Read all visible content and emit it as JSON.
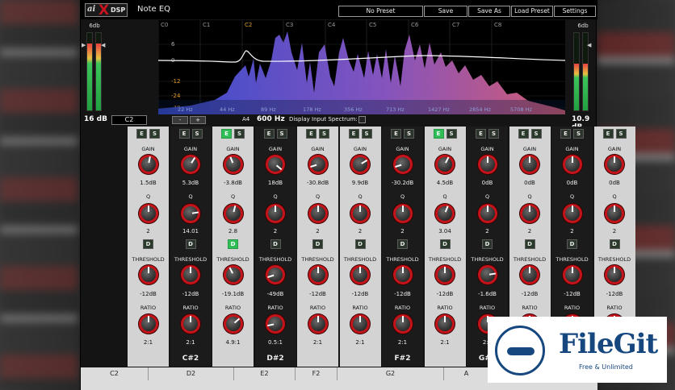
{
  "app": {
    "brand_ai": "ai",
    "brand_x": "X",
    "brand_dsp": "DSP",
    "title": "Note EQ"
  },
  "toolbar": {
    "preset_label": "No Preset",
    "save_label": "Save",
    "save_as_label": "Save As",
    "load_preset_label": "Load Preset",
    "settings_label": "Settings"
  },
  "meters": {
    "left_label": "6db",
    "right_label": "6db",
    "left_value": "16 dB",
    "right_value": "10.9 dB",
    "left_levels": [
      0.86,
      0.86
    ],
    "right_levels": [
      0.6,
      0.6
    ]
  },
  "spectrum": {
    "note_labels": [
      "C0",
      "C1",
      "C2",
      "C3",
      "C4",
      "C5",
      "C6",
      "C7",
      "C8"
    ],
    "db_labels": [
      "6",
      "0",
      "-12",
      "-24",
      "-48"
    ],
    "freq_labels": [
      "22 Hz",
      "44 Hz",
      "89 Hz",
      "178 Hz",
      "356 Hz",
      "713 Hz",
      "1427 Hz",
      "2854 Hz",
      "5708 Hz"
    ],
    "colors": {
      "low": "#3a50d8",
      "high": "#e06078",
      "active_note": "#e0a030",
      "curve": "#ffffff"
    }
  },
  "controls": {
    "note": "C2",
    "minus": "-",
    "plus": "+",
    "ref_note": "A4",
    "ref_freq": "600 Hz",
    "display_input_label": "Display Input Spectrum:"
  },
  "labels": {
    "enable": "E",
    "solo": "S",
    "dynamic": "D",
    "gain": "GAIN",
    "q": "Q",
    "threshold": "THRESHOLD",
    "ratio": "RATIO"
  },
  "bands": [
    {
      "name": "",
      "theme": "light",
      "e_on": false,
      "d_on": false,
      "gain": "1.5dB",
      "q": "2",
      "threshold": "-12dB",
      "ratio": "2:1",
      "gain_level": 0.54,
      "q_level": 0.5,
      "threshold_level": 0.5,
      "ratio_level": 0.5
    },
    {
      "name": "C#2",
      "theme": "dark",
      "e_on": false,
      "d_on": false,
      "gain": "5.3dB",
      "q": "14.01",
      "threshold": "-12dB",
      "ratio": "2:1",
      "gain_level": 0.62,
      "q_level": 0.8,
      "threshold_level": 0.5,
      "ratio_level": 0.5
    },
    {
      "name": "",
      "theme": "light",
      "e_on": true,
      "d_on": true,
      "gain": "-3.8dB",
      "q": "2.8",
      "threshold": "-19.1dB",
      "ratio": "4.9:1",
      "gain_level": 0.42,
      "q_level": 0.55,
      "threshold_level": 0.4,
      "ratio_level": 0.68
    },
    {
      "name": "D#2",
      "theme": "dark",
      "e_on": false,
      "d_on": false,
      "gain": "18dB",
      "q": "2",
      "threshold": "-49dB",
      "ratio": "0.5:1",
      "gain_level": 0.98,
      "q_level": 0.5,
      "threshold_level": 0.1,
      "ratio_level": 0.12
    },
    {
      "name": "",
      "theme": "light",
      "e_on": false,
      "d_on": false,
      "gain": "-30.8dB",
      "q": "2",
      "threshold": "-12dB",
      "ratio": "2:1",
      "gain_level": 0.1,
      "q_level": 0.5,
      "threshold_level": 0.5,
      "ratio_level": 0.5
    },
    {
      "name": "",
      "theme": "light",
      "e_on": false,
      "d_on": false,
      "gain": "9.9dB",
      "q": "2",
      "threshold": "-12dB",
      "ratio": "2:1",
      "gain_level": 0.72,
      "q_level": 0.5,
      "threshold_level": 0.5,
      "ratio_level": 0.5
    },
    {
      "name": "F#2",
      "theme": "dark",
      "e_on": false,
      "d_on": false,
      "gain": "-30.2dB",
      "q": "2",
      "threshold": "-12dB",
      "ratio": "2:1",
      "gain_level": 0.1,
      "q_level": 0.5,
      "threshold_level": 0.5,
      "ratio_level": 0.5
    },
    {
      "name": "",
      "theme": "light",
      "e_on": true,
      "d_on": false,
      "gain": "4.5dB",
      "q": "3.04",
      "threshold": "-12dB",
      "ratio": "2:1",
      "gain_level": 0.6,
      "q_level": 0.58,
      "threshold_level": 0.5,
      "ratio_level": 0.5
    },
    {
      "name": "G#2",
      "theme": "dark",
      "e_on": false,
      "d_on": false,
      "gain": "0dB",
      "q": "2",
      "threshold": "-1.6dB",
      "ratio": "2:1",
      "gain_level": 0.5,
      "q_level": 0.5,
      "threshold_level": 0.8,
      "ratio_level": 0.5
    },
    {
      "name": "",
      "theme": "light",
      "e_on": false,
      "d_on": false,
      "gain": "0dB",
      "q": "2",
      "threshold": "-12dB",
      "ratio": "",
      "gain_level": 0.5,
      "q_level": 0.5,
      "threshold_level": 0.5,
      "ratio_level": 0.5
    },
    {
      "name": "",
      "theme": "dark",
      "e_on": false,
      "d_on": false,
      "gain": "0dB",
      "q": "2",
      "threshold": "-12dB",
      "ratio": "",
      "gain_level": 0.5,
      "q_level": 0.5,
      "threshold_level": 0.5,
      "ratio_level": 0.5
    },
    {
      "name": "",
      "theme": "light",
      "e_on": false,
      "d_on": false,
      "gain": "0dB",
      "q": "2",
      "threshold": "-12dB",
      "ratio": "",
      "gain_level": 0.5,
      "q_level": 0.5,
      "threshold_level": 0.5,
      "ratio_level": 0.5
    }
  ],
  "bottom_notes": [
    "C2",
    "D2",
    "E2",
    "F2",
    "G2",
    "A"
  ],
  "watermark": {
    "brand": "FileGit",
    "tagline": "Free & Unlimited"
  }
}
